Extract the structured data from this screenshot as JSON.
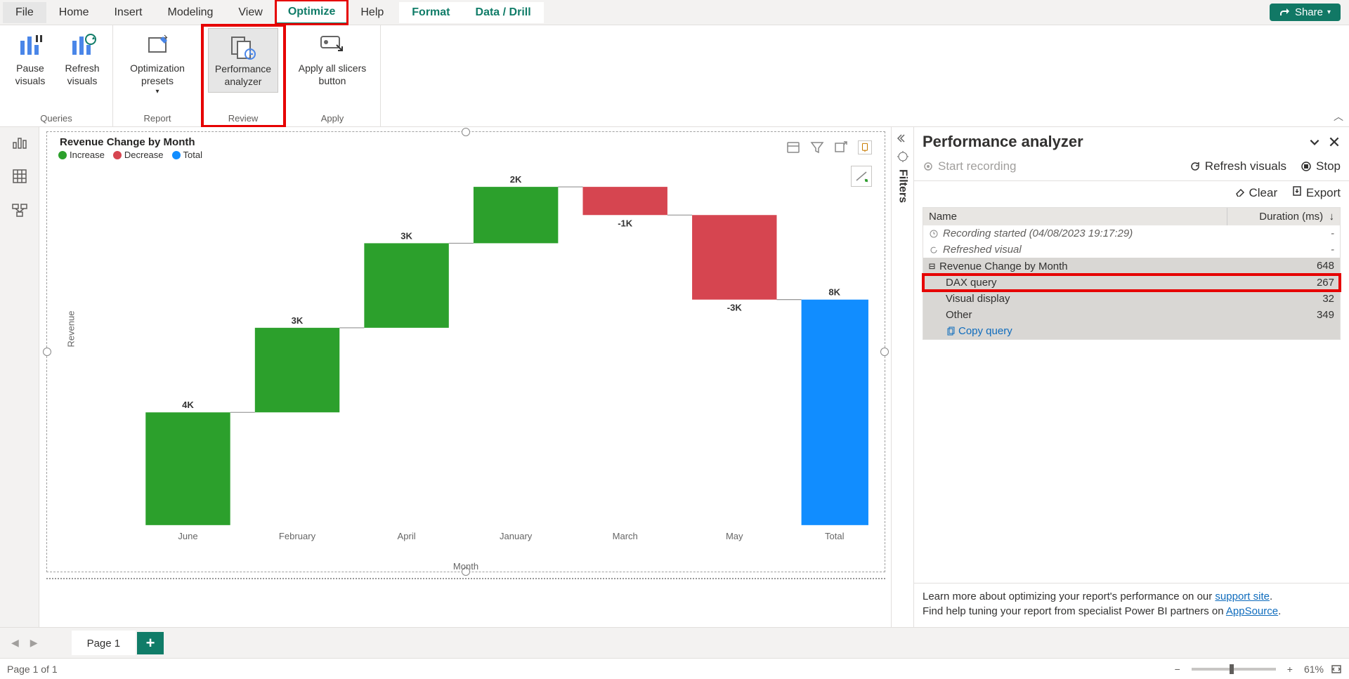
{
  "menu": {
    "file": "File",
    "home": "Home",
    "insert": "Insert",
    "modeling": "Modeling",
    "view": "View",
    "optimize": "Optimize",
    "help": "Help",
    "format": "Format",
    "datadrill": "Data / Drill",
    "share": "Share"
  },
  "ribbon": {
    "pause_visuals": "Pause visuals",
    "refresh_visuals": "Refresh visuals",
    "optimization_presets": "Optimization presets",
    "performance_analyzer": "Performance analyzer",
    "apply_slicers": "Apply all slicers button",
    "group_queries": "Queries",
    "group_report": "Report",
    "group_review": "Review",
    "group_apply": "Apply"
  },
  "chart": {
    "title": "Revenue Change by Month",
    "legend_increase": "Increase",
    "legend_decrease": "Decrease",
    "legend_total": "Total",
    "ylabel": "Revenue",
    "xlabel": "Month"
  },
  "chart_data": {
    "type": "bar",
    "subtype": "waterfall",
    "title": "Revenue Change by Month",
    "xlabel": "Month",
    "ylabel": "Revenue",
    "legend": [
      "Increase",
      "Decrease",
      "Total"
    ],
    "colors": {
      "Increase": "#2ca02c",
      "Decrease": "#d64550",
      "Total": "#118dff"
    },
    "categories": [
      "June",
      "February",
      "April",
      "January",
      "March",
      "May",
      "Total"
    ],
    "values": [
      4000,
      3000,
      3000,
      2000,
      -1000,
      -3000,
      8000
    ],
    "data_labels": [
      "4K",
      "3K",
      "3K",
      "2K",
      "-1K",
      "-3K",
      "8K"
    ],
    "cumulative": [
      0,
      4000,
      7000,
      10000,
      12000,
      11000,
      8000
    ],
    "ylim": [
      0,
      12500
    ]
  },
  "filters": {
    "label": "Filters"
  },
  "perf": {
    "title": "Performance analyzer",
    "start": "Start recording",
    "refresh": "Refresh visuals",
    "stop": "Stop",
    "clear": "Clear",
    "export": "Export",
    "col_name": "Name",
    "col_duration": "Duration (ms)",
    "rows": {
      "rec_started": "Recording started (04/08/2023 19:17:29)",
      "refreshed": "Refreshed visual",
      "visual_name": "Revenue Change by Month",
      "visual_dur": "648",
      "dax": "DAX query",
      "dax_dur": "267",
      "display": "Visual display",
      "display_dur": "32",
      "other": "Other",
      "other_dur": "349",
      "copy": "Copy query"
    },
    "footer_line1a": "Learn more about optimizing your report's performance on our ",
    "footer_link1": "support site",
    "footer_line2": "Find help tuning your report from specialist Power BI partners on ",
    "footer_link2": "AppSource"
  },
  "pages": {
    "page1": "Page 1"
  },
  "status": {
    "page_pos": "Page 1 of 1",
    "zoom": "61%"
  }
}
